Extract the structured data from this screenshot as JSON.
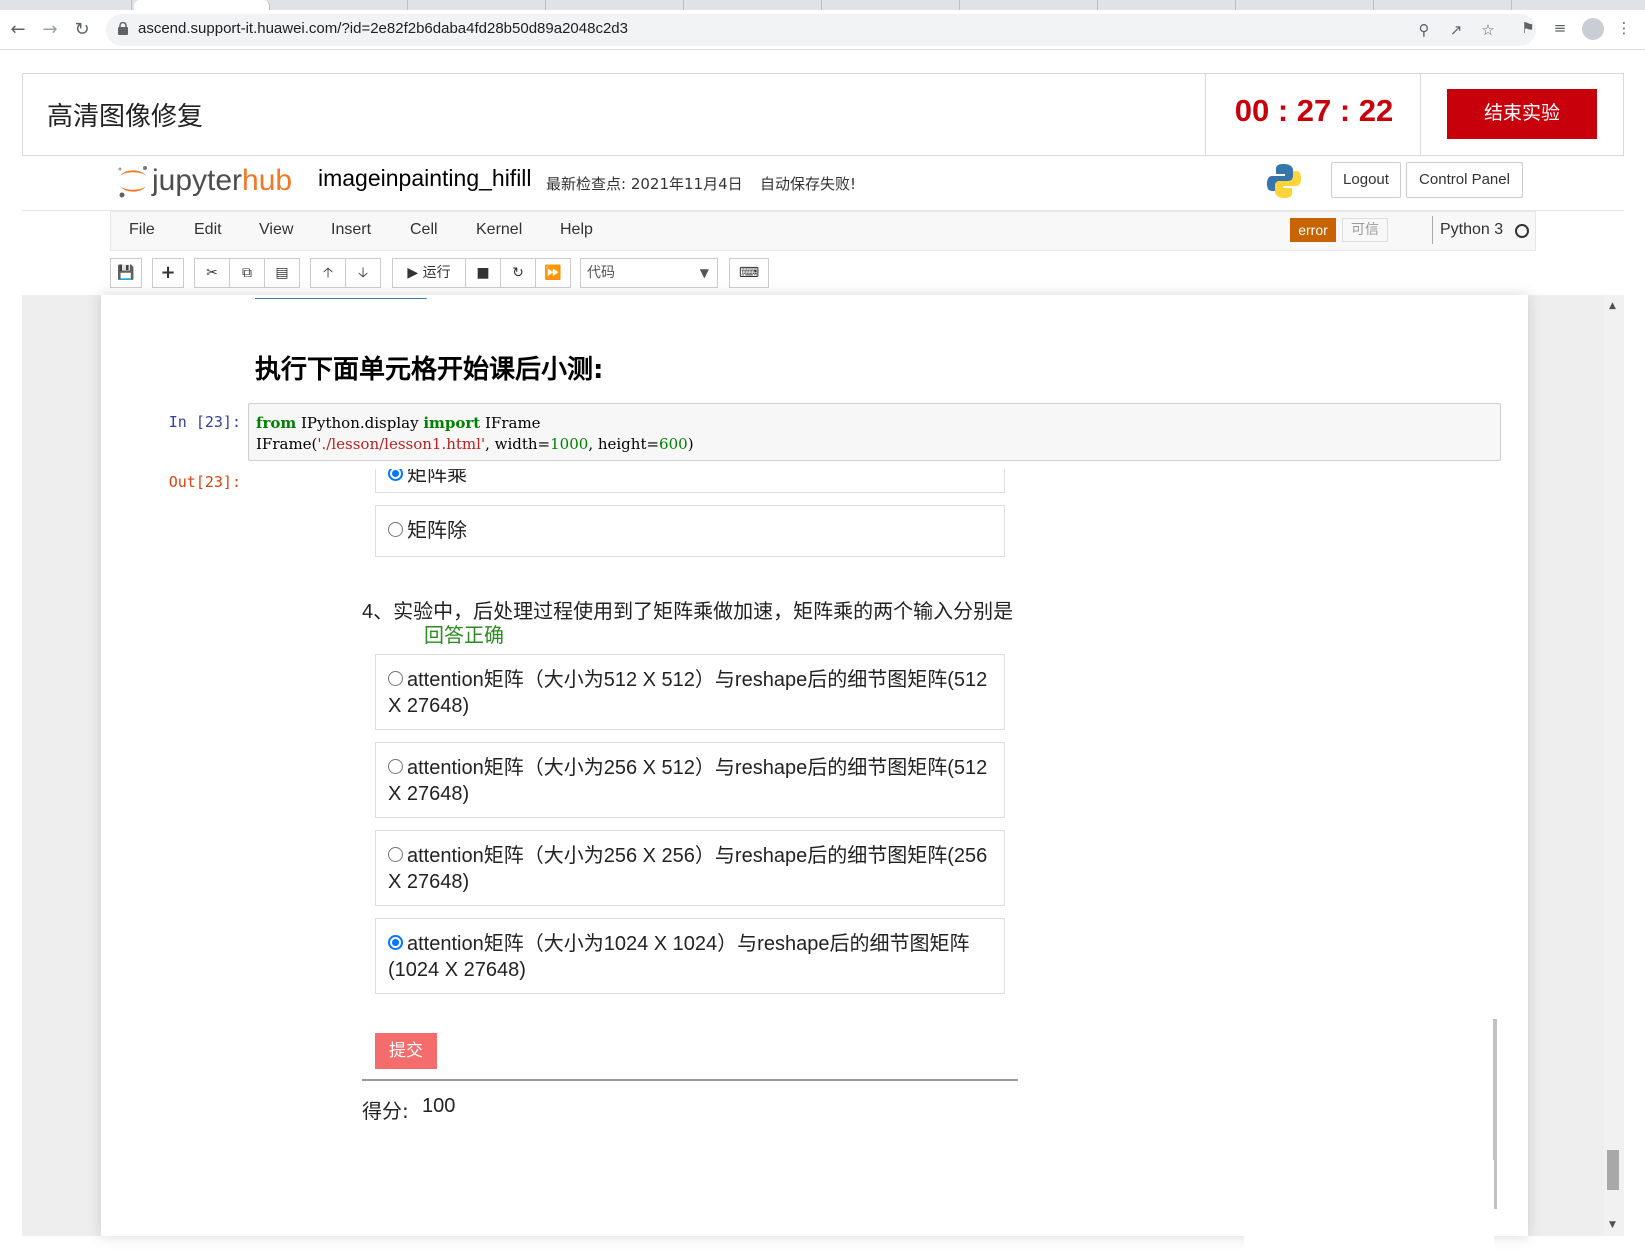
{
  "browser": {
    "url": "ascend.support-it.huawei.com/?id=2e82f2b6daba4fd28b50d89a2048c2d3"
  },
  "lab": {
    "title": "高清图像修复",
    "timer": "00 : 27 : 22",
    "end_button": "结束实验"
  },
  "jupyter": {
    "brand_jupyter": "jupyter",
    "brand_hub": "hub",
    "notebook_name": "imageinpainting_hifill",
    "checkpoint": "最新检查点: 2021年11月4日",
    "autosave": "自动保存失败!",
    "logout": "Logout",
    "control_panel": "Control Panel",
    "menu": [
      "File",
      "Edit",
      "View",
      "Insert",
      "Cell",
      "Kernel",
      "Help"
    ],
    "error_badge": "error",
    "trusted": "可信",
    "kernel": "Python 3",
    "toolbar": {
      "run_label": "运行",
      "cell_type": "代码"
    }
  },
  "notebook": {
    "heading": "执行下面单元格开始课后小测:",
    "in_prompt": "In  [23]:",
    "out_prompt": "Out[23]:",
    "code": {
      "line1": {
        "kw1": "from",
        "mod": " IPython.display ",
        "kw2": "import",
        "name": " IFrame"
      },
      "line2": {
        "fn": "IFrame(",
        "str": "'./lesson/lesson1.html'",
        "sep1": ", width=",
        "n1": "1000",
        "sep2": ", height=",
        "n2": "600",
        "end": ")"
      }
    }
  },
  "quiz": {
    "prev_option_selected": "矩阵乘",
    "prev_option_divide": "矩阵除",
    "q4_text": "4、实验中，后处理过程使用到了矩阵乘做加速，矩阵乘的两个输入分别是",
    "q4_result": "回答正确",
    "options": [
      {
        "line1": "attention矩阵（大小为512 X 512）与reshape后的细节图矩阵(512",
        "line2": "X 27648)",
        "selected": false
      },
      {
        "line1": "attention矩阵（大小为256 X 512）与reshape后的细节图矩阵(512",
        "line2": "X 27648)",
        "selected": false
      },
      {
        "line1": "attention矩阵（大小为256 X 256）与reshape后的细节图矩阵(256",
        "line2": "X 27648)",
        "selected": false
      },
      {
        "line1": "attention矩阵（大小为1024 X 1024）与reshape后的细节图矩阵",
        "line2": "(1024 X 27648)",
        "selected": true
      }
    ],
    "submit": "提交",
    "score_label": "得分:",
    "score_value": "100"
  },
  "colors": {
    "brand_red": "#c7000b",
    "jupyter_orange": "#f37726",
    "correct_green": "#2e8b22",
    "submit_red": "#f56c6c"
  }
}
